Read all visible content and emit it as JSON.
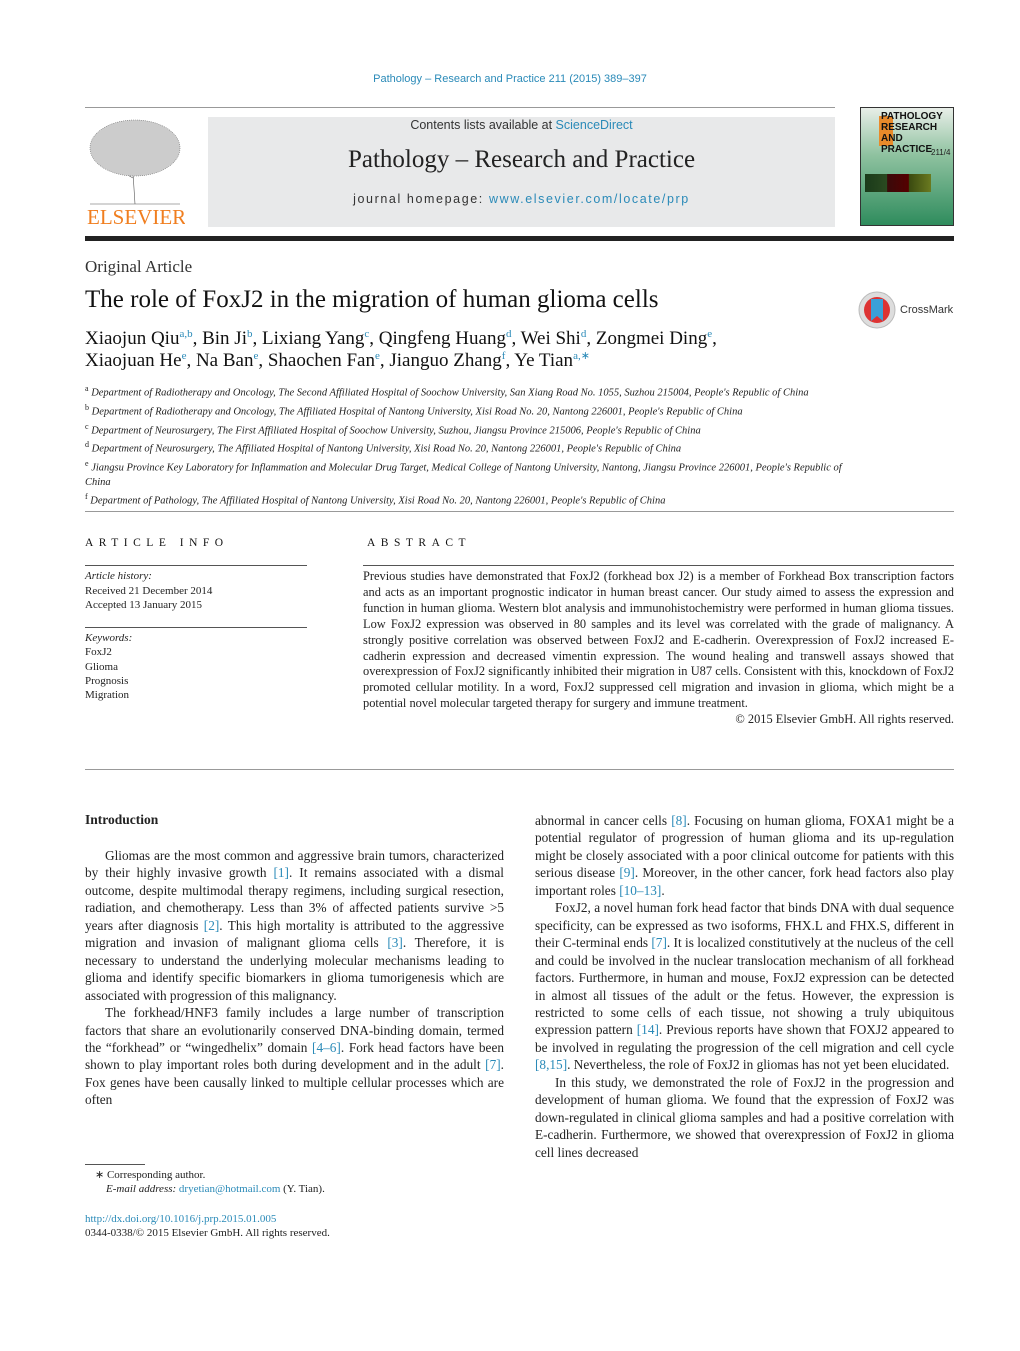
{
  "header": {
    "citation": "Pathology – Research and Practice 211 (2015) 389–397",
    "contents_prefix": "Contents lists available at ",
    "contents_link": "ScienceDirect",
    "journal_title": "Pathology – Research and Practice",
    "homepage_prefix": "journal homepage: ",
    "homepage_link": "www.elsevier.com/locate/prp",
    "publisher_logo": "ELSEVIER",
    "cover_title": "PATHOLOGY RESEARCH AND PRACTICE",
    "cover_volume": "211/4"
  },
  "article": {
    "type": "Original Article",
    "title": "The role of FoxJ2 in the migration of human glioma cells",
    "crossmark": "CrossMark",
    "authors": [
      {
        "t": "Xiaojun Qiu"
      },
      {
        "sup": "a,b"
      },
      {
        "t": ", Bin Ji"
      },
      {
        "sup": "b"
      },
      {
        "t": ", Lixiang Yang"
      },
      {
        "sup": "c"
      },
      {
        "t": ", Qingfeng Huang"
      },
      {
        "sup": "d"
      },
      {
        "t": ", Wei Shi"
      },
      {
        "sup": "d"
      },
      {
        "t": ", Zongmei Ding"
      },
      {
        "sup": "e"
      },
      {
        "t": ","
      },
      {
        "br": true
      },
      {
        "t": "Xiaojuan He"
      },
      {
        "sup": "e"
      },
      {
        "t": ", Na Ban"
      },
      {
        "sup": "e"
      },
      {
        "t": ", Shaochen Fan"
      },
      {
        "sup": "e"
      },
      {
        "t": ", Jianguo Zhang"
      },
      {
        "sup": "f"
      },
      {
        "t": ", Ye Tian"
      },
      {
        "sup": "a,∗"
      }
    ],
    "affiliations": [
      {
        "key": "a",
        "text": "Department of Radiotherapy and Oncology, The Second Affiliated Hospital of Soochow University, San Xiang Road No. 1055, Suzhou 215004, People's Republic of China"
      },
      {
        "key": "b",
        "text": "Department of Radiotherapy and Oncology, The Affiliated Hospital of Nantong University, Xisi Road No. 20, Nantong 226001, People's Republic of China"
      },
      {
        "key": "c",
        "text": "Department of Neurosurgery, The First Affiliated Hospital of Soochow University, Suzhou, Jiangsu Province 215006, People's Republic of China"
      },
      {
        "key": "d",
        "text": "Department of Neurosurgery, The Affiliated Hospital of Nantong University, Xisi Road No. 20, Nantong 226001, People's Republic of China"
      },
      {
        "key": "e",
        "text": "Jiangsu Province Key Laboratory for Inflammation and Molecular Drug Target, Medical College of Nantong University, Nantong, Jiangsu Province 226001, People's Republic of China"
      },
      {
        "key": "f",
        "text": "Department of Pathology, The Affiliated Hospital of Nantong University, Xisi Road No. 20, Nantong 226001, People's Republic of China"
      }
    ]
  },
  "article_info": {
    "heading": "ARTICLE INFO",
    "history_label": "Article history:",
    "received": "Received 21 December 2014",
    "accepted": "Accepted 13 January 2015",
    "keywords_label": "Keywords:",
    "keywords": [
      "FoxJ2",
      "Glioma",
      "Prognosis",
      "Migration"
    ]
  },
  "abstract": {
    "heading": "ABSTRACT",
    "text": "Previous studies have demonstrated that FoxJ2 (forkhead box J2) is a member of Forkhead Box transcription factors and acts as an important prognostic indicator in human breast cancer. Our study aimed to assess the expression and function in human glioma. Western blot analysis and immunohistochemistry were performed in human glioma tissues. Low FoxJ2 expression was observed in 80 samples and its level was correlated with the grade of malignancy. A strongly positive correlation was observed between FoxJ2 and E-cadherin. Overexpression of FoxJ2 increased E-cadherin expression and decreased vimentin expression. The wound healing and transwell assays showed that overexpression of FoxJ2 significantly inhibited their migration in U87 cells. Consistent with this, knockdown of FoxJ2 promoted cellular motility. In a word, FoxJ2 suppressed cell migration and invasion in glioma, which might be a potential novel molecular targeted therapy for surgery and immune treatment.",
    "copyright": "© 2015 Elsevier GmbH. All rights reserved."
  },
  "body": {
    "intro_heading": "Introduction",
    "col1": [
      [
        {
          "t": "Gliomas are the most common and aggressive brain tumors, characterized by their highly invasive growth "
        },
        {
          "ref": "[1]"
        },
        {
          "t": ". It remains associated with a dismal outcome, despite multimodal therapy regimens, including surgical resection, radiation, and chemotherapy. Less than 3% of affected patients survive >5 years after diagnosis "
        },
        {
          "ref": "[2]"
        },
        {
          "t": ". This high mortality is attributed to the aggressive migration and invasion of malignant glioma cells "
        },
        {
          "ref": "[3]"
        },
        {
          "t": ". Therefore, it is necessary to understand the underlying molecular mechanisms leading to glioma and identify specific biomarkers in glioma tumorigenesis which are associated with progression of this malignancy."
        }
      ],
      [
        {
          "t": "The forkhead/HNF3 family includes a large number of transcription factors that share an evolutionarily conserved DNA-binding domain, termed the “forkhead” or “wingedhelix” domain "
        },
        {
          "ref": "[4–6]"
        },
        {
          "t": ". Fork head factors have been shown to play important roles both during development and in the adult "
        },
        {
          "ref": "[7]"
        },
        {
          "t": ". Fox genes have been causally linked to multiple cellular processes which are often"
        }
      ]
    ],
    "col2": [
      [
        {
          "t": "abnormal in cancer cells "
        },
        {
          "ref": "[8]"
        },
        {
          "t": ". Focusing on human glioma, FOXA1 might be a potential regulator of progression of human glioma and its up-regulation might be closely associated with a poor clinical outcome for patients with this serious disease "
        },
        {
          "ref": "[9]"
        },
        {
          "t": ". Moreover, in the other cancer, fork head factors also play important roles "
        },
        {
          "ref": "[10–13]"
        },
        {
          "t": "."
        }
      ],
      [
        {
          "t": "FoxJ2, a novel human fork head factor that binds DNA with dual sequence specificity, can be expressed as two isoforms, FHX.L and FHX.S, different in their C-terminal ends "
        },
        {
          "ref": "[7]"
        },
        {
          "t": ". It is localized constitutively at the nucleus of the cell and could be involved in the nuclear translocation mechanism of all forkhead factors. Furthermore, in human and mouse, FoxJ2 expression can be detected in almost all tissues of the adult or the fetus. However, the expression is restricted to some cells of each tissue, not showing a truly ubiquitous expression pattern "
        },
        {
          "ref": "[14]"
        },
        {
          "t": ". Previous reports have shown that FOXJ2 appeared to be involved in regulating the progression of the cell migration and cell cycle "
        },
        {
          "ref": "[8,15]"
        },
        {
          "t": ". Nevertheless, the role of FoxJ2 in gliomas has not yet been elucidated."
        }
      ],
      [
        {
          "t": "In this study, we demonstrated the role of FoxJ2 in the progression and development of human glioma. We found that the expression of FoxJ2 was down-regulated in clinical glioma samples and had a positive correlation with E-cadherin. Furthermore, we showed that overexpression of FoxJ2 in glioma cell lines decreased"
        }
      ]
    ]
  },
  "footnote": {
    "mark": "∗",
    "corresponding": "Corresponding author.",
    "email_label": "E-mail address: ",
    "email": "dryetian@hotmail.com",
    "email_suffix": " (Y. Tian)."
  },
  "doi": {
    "link": "http://dx.doi.org/10.1016/j.prp.2015.01.005",
    "issn": "0344-0338/© 2015 Elsevier GmbH. All rights reserved."
  },
  "colors": {
    "link": "#2a8ab8",
    "elsevier_orange": "#f07e1f",
    "banner_bg": "#e8e9ea"
  }
}
